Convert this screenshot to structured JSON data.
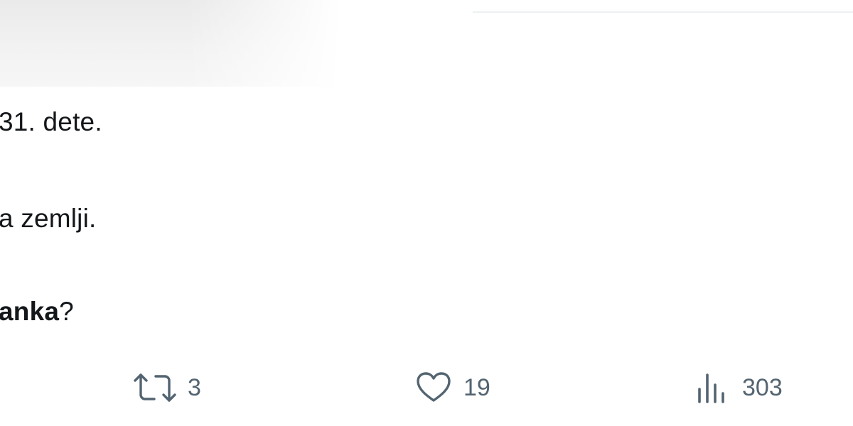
{
  "tweet": {
    "text_lines": [
      {
        "segments": [
          {
            "text": "31. dete.",
            "bold": false
          }
        ]
      },
      {
        "segments": [
          {
            "text": "a zemlji.",
            "bold": false
          }
        ]
      },
      {
        "segments": [
          {
            "text": "anka",
            "bold": true
          },
          {
            "text": "?",
            "bold": false
          }
        ]
      }
    ]
  },
  "actions": {
    "retweet": {
      "icon": "retweet-icon",
      "count": "3"
    },
    "like": {
      "icon": "heart-icon",
      "count": "19"
    },
    "views": {
      "icon": "views-chart-icon",
      "count": "303"
    }
  },
  "colors": {
    "text": "#14171a",
    "action_gray": "#536471",
    "divider": "#eef1f3"
  }
}
